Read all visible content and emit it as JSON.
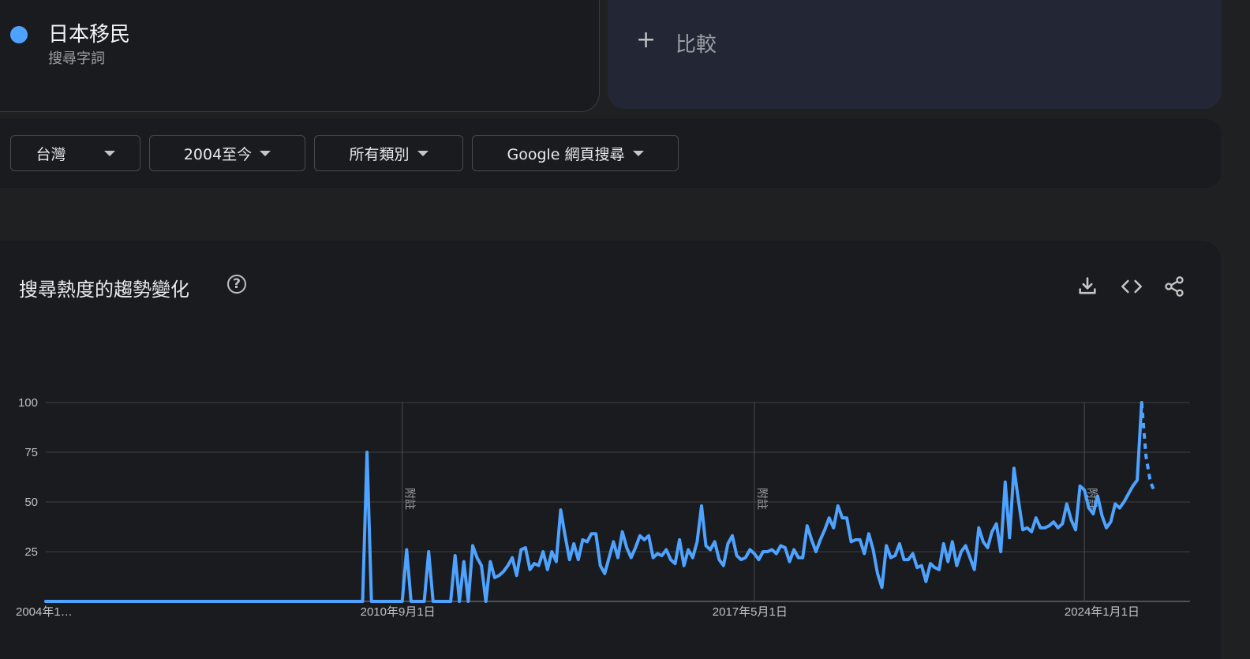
{
  "search_term": {
    "name": "日本移民",
    "type": "搜尋字詞",
    "color": "#4da3ff"
  },
  "compare": {
    "label": "比較"
  },
  "filters": [
    {
      "label": "台灣"
    },
    {
      "label": "2004至今"
    },
    {
      "label": "所有類別"
    },
    {
      "label": "Google 網頁搜尋"
    }
  ],
  "chart_section": {
    "title": "搜尋熱度的趨勢變化"
  },
  "toolbar_icons": [
    "download-icon",
    "embed-code-icon",
    "share-icon"
  ],
  "annotation_label": "附註",
  "chart_data": {
    "type": "line",
    "title": "搜尋熱度的趨勢變化",
    "xlabel": "",
    "ylabel": "",
    "ylim": [
      0,
      100
    ],
    "yticks": [
      25,
      50,
      75,
      100
    ],
    "x_tick_labels": [
      "2004年1…",
      "2010年9月1日",
      "2017年5月1日",
      "2024年1月1日"
    ],
    "x_start": "2004-01",
    "x_end": "2025-09",
    "grid": true,
    "legend": "none",
    "line_color": "#4da3ff",
    "annotations": [
      "2010-10",
      "2017-06",
      "2023-09"
    ],
    "series": [
      {
        "values": [
          0,
          0,
          0,
          0,
          0,
          0,
          0,
          0,
          0,
          0,
          0,
          0,
          0,
          0,
          0,
          0,
          0,
          0,
          0,
          0,
          0,
          0,
          0,
          0,
          0,
          0,
          0,
          0,
          0,
          0,
          0,
          0,
          0,
          0,
          0,
          0,
          0,
          0,
          0,
          0,
          0,
          0,
          0,
          0,
          0,
          0,
          0,
          0,
          0,
          0,
          0,
          0,
          0,
          0,
          0,
          0,
          0,
          0,
          0,
          0,
          0,
          0,
          0,
          0,
          0,
          0,
          0,
          0,
          0,
          0,
          0,
          0,
          75,
          0,
          0,
          0,
          0,
          0,
          0,
          0,
          0,
          0,
          0,
          0,
          0,
          0,
          0,
          0,
          0,
          0,
          0,
          0,
          0,
          0,
          0,
          0,
          0,
          0,
          0,
          0,
          0,
          0,
          0,
          0,
          0,
          0,
          0,
          0,
          0,
          0,
          0,
          0,
          0,
          0,
          0,
          0,
          0,
          0,
          0,
          0,
          0,
          0,
          0,
          0,
          0,
          0,
          0,
          0,
          0,
          0,
          0,
          0,
          0,
          0,
          0,
          0,
          0,
          0,
          0,
          0,
          0,
          0,
          0,
          0,
          0,
          0,
          0,
          0,
          0,
          0,
          0,
          0,
          0,
          0,
          0,
          0,
          0,
          0,
          0,
          0,
          0,
          0,
          0,
          0,
          0,
          0,
          0,
          0,
          0,
          0,
          0,
          0,
          0,
          0,
          0,
          0,
          0,
          0,
          0,
          0,
          0,
          0,
          0,
          0,
          0,
          0,
          0,
          0,
          0,
          0,
          0,
          0,
          0,
          0,
          0,
          0,
          0,
          0,
          0,
          0,
          0,
          0,
          0,
          0,
          0,
          0,
          0,
          0,
          0,
          0,
          0,
          0,
          0,
          0,
          0,
          0,
          0,
          0,
          0,
          0,
          0,
          0,
          0,
          0,
          0,
          0,
          0,
          0,
          0,
          0,
          0,
          0,
          0,
          0,
          0,
          0,
          0,
          0,
          0,
          0,
          0,
          0,
          0,
          0,
          0,
          0,
          0,
          0,
          0,
          0,
          0,
          0,
          0,
          0,
          0,
          0,
          0,
          0,
          0,
          0,
          0,
          0,
          0,
          0,
          0,
          0,
          0,
          0,
          0,
          0,
          0,
          0,
          0,
          0,
          0,
          0,
          0,
          0,
          0,
          0,
          0,
          0,
          0,
          0,
          0,
          0,
          0,
          0,
          0,
          0,
          0
        ],
        "points": [
          [
            "2004-01",
            0
          ],
          [
            "2010-01",
            0
          ],
          [
            "2010-02",
            75
          ],
          [
            "2010-03",
            0
          ],
          [
            "2010-09",
            0
          ],
          [
            "2010-10",
            0
          ],
          [
            "2010-11",
            26
          ],
          [
            "2010-12",
            0
          ],
          [
            "2011-03",
            0
          ],
          [
            "2011-04",
            25
          ],
          [
            "2011-05",
            0
          ],
          [
            "2011-09",
            0
          ],
          [
            "2011-10",
            23
          ],
          [
            "2011-11",
            0
          ],
          [
            "2011-12",
            20
          ],
          [
            "2012-01",
            0
          ],
          [
            "2012-02",
            28
          ],
          [
            "2012-03",
            22
          ],
          [
            "2012-04",
            18
          ],
          [
            "2012-05",
            0
          ],
          [
            "2012-06",
            20
          ],
          [
            "2012-07",
            12
          ],
          [
            "2012-08",
            13
          ],
          [
            "2012-09",
            15
          ],
          [
            "2012-10",
            18
          ],
          [
            "2012-11",
            22
          ],
          [
            "2012-12",
            13
          ],
          [
            "2013-01",
            26
          ],
          [
            "2013-02",
            27
          ],
          [
            "2013-03",
            16
          ],
          [
            "2013-04",
            19
          ],
          [
            "2013-05",
            18
          ],
          [
            "2013-06",
            25
          ],
          [
            "2013-07",
            16
          ],
          [
            "2013-08",
            25
          ],
          [
            "2013-09",
            20
          ],
          [
            "2013-10",
            46
          ],
          [
            "2013-11",
            33
          ],
          [
            "2013-12",
            21
          ],
          [
            "2014-01",
            29
          ],
          [
            "2014-02",
            21
          ],
          [
            "2014-03",
            31
          ],
          [
            "2014-04",
            30
          ],
          [
            "2014-05",
            34
          ],
          [
            "2014-06",
            34
          ],
          [
            "2014-07",
            18
          ],
          [
            "2014-08",
            14
          ],
          [
            "2014-09",
            22
          ],
          [
            "2014-10",
            30
          ],
          [
            "2014-11",
            22
          ],
          [
            "2014-12",
            35
          ],
          [
            "2015-01",
            27
          ],
          [
            "2015-02",
            22
          ],
          [
            "2015-03",
            27
          ],
          [
            "2015-04",
            33
          ],
          [
            "2015-05",
            31
          ],
          [
            "2015-06",
            33
          ],
          [
            "2015-07",
            22
          ],
          [
            "2015-08",
            24
          ],
          [
            "2015-09",
            23
          ],
          [
            "2015-10",
            26
          ],
          [
            "2015-11",
            21
          ],
          [
            "2015-12",
            19
          ],
          [
            "2016-01",
            31
          ],
          [
            "2016-02",
            18
          ],
          [
            "2016-03",
            26
          ],
          [
            "2016-04",
            22
          ],
          [
            "2016-05",
            30
          ],
          [
            "2016-06",
            48
          ],
          [
            "2016-07",
            28
          ],
          [
            "2016-08",
            26
          ],
          [
            "2016-09",
            30
          ],
          [
            "2016-10",
            21
          ],
          [
            "2016-11",
            18
          ],
          [
            "2016-12",
            29
          ],
          [
            "2017-01",
            33
          ],
          [
            "2017-02",
            23
          ],
          [
            "2017-03",
            21
          ],
          [
            "2017-04",
            22
          ],
          [
            "2017-05",
            26
          ],
          [
            "2017-06",
            24
          ],
          [
            "2017-07",
            21
          ],
          [
            "2017-08",
            25
          ],
          [
            "2017-09",
            25
          ],
          [
            "2017-10",
            26
          ],
          [
            "2017-11",
            24
          ],
          [
            "2017-12",
            28
          ],
          [
            "2018-01",
            27
          ],
          [
            "2018-02",
            20
          ],
          [
            "2018-03",
            26
          ],
          [
            "2018-04",
            22
          ],
          [
            "2018-05",
            22
          ],
          [
            "2018-06",
            38
          ],
          [
            "2018-07",
            31
          ],
          [
            "2018-08",
            25
          ],
          [
            "2018-09",
            31
          ],
          [
            "2018-10",
            36
          ],
          [
            "2018-11",
            42
          ],
          [
            "2018-12",
            37
          ],
          [
            "2019-01",
            48
          ],
          [
            "2019-02",
            42
          ],
          [
            "2019-03",
            42
          ],
          [
            "2019-04",
            30
          ],
          [
            "2019-05",
            31
          ],
          [
            "2019-06",
            31
          ],
          [
            "2019-07",
            24
          ],
          [
            "2019-08",
            34
          ],
          [
            "2019-09",
            26
          ],
          [
            "2019-10",
            14
          ],
          [
            "2019-11",
            7
          ],
          [
            "2019-12",
            28
          ],
          [
            "2020-01",
            22
          ],
          [
            "2020-02",
            23
          ],
          [
            "2020-03",
            29
          ],
          [
            "2020-04",
            21
          ],
          [
            "2020-05",
            21
          ],
          [
            "2020-06",
            24
          ],
          [
            "2020-07",
            17
          ],
          [
            "2020-08",
            18
          ],
          [
            "2020-09",
            10
          ],
          [
            "2020-10",
            19
          ],
          [
            "2020-11",
            17
          ],
          [
            "2020-12",
            16
          ],
          [
            "2021-01",
            29
          ],
          [
            "2021-02",
            20
          ],
          [
            "2021-03",
            30
          ],
          [
            "2021-04",
            18
          ],
          [
            "2021-05",
            25
          ],
          [
            "2021-06",
            28
          ],
          [
            "2021-07",
            22
          ],
          [
            "2021-08",
            16
          ],
          [
            "2021-09",
            37
          ],
          [
            "2021-10",
            30
          ],
          [
            "2021-11",
            27
          ],
          [
            "2021-12",
            35
          ],
          [
            "2022-01",
            39
          ],
          [
            "2022-02",
            25
          ],
          [
            "2022-03",
            60
          ],
          [
            "2022-04",
            32
          ],
          [
            "2022-05",
            67
          ],
          [
            "2022-06",
            51
          ],
          [
            "2022-07",
            36
          ],
          [
            "2022-08",
            37
          ],
          [
            "2022-09",
            35
          ],
          [
            "2022-10",
            42
          ],
          [
            "2022-11",
            37
          ],
          [
            "2022-12",
            37
          ],
          [
            "2023-01",
            38
          ],
          [
            "2023-02",
            40
          ],
          [
            "2023-03",
            37
          ],
          [
            "2023-04",
            39
          ],
          [
            "2023-05",
            49
          ],
          [
            "2023-06",
            41
          ],
          [
            "2023-07",
            36
          ],
          [
            "2023-08",
            58
          ],
          [
            "2023-09",
            56
          ],
          [
            "2023-10",
            47
          ],
          [
            "2023-11",
            44
          ],
          [
            "2023-12",
            53
          ],
          [
            "2024-01",
            43
          ],
          [
            "2024-02",
            37
          ],
          [
            "2024-03",
            40
          ],
          [
            "2024-04",
            49
          ],
          [
            "2024-05",
            47
          ],
          [
            "2024-06",
            50
          ],
          [
            "2024-07",
            54
          ],
          [
            "2024-08",
            58
          ],
          [
            "2024-09",
            61
          ],
          [
            "2024-10",
            100
          ],
          [
            "2024-11",
            73
          ],
          [
            "2024-12",
            60
          ],
          [
            "2025-01",
            55
          ]
        ],
        "partial_from": "2024-11"
      }
    ]
  }
}
